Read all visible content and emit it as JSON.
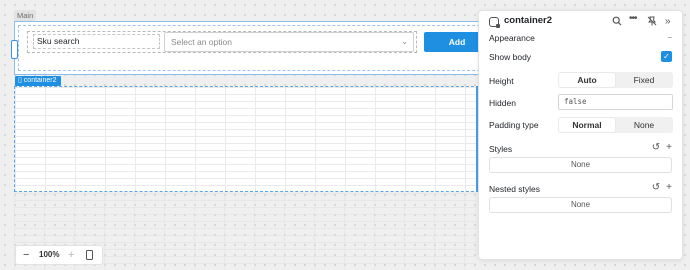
{
  "canvas": {
    "main_tag": "Main",
    "container_tag": "container2",
    "sku_label": "Sku search",
    "select_placeholder": "Select an option",
    "add_button_label": "Add",
    "zoom": {
      "minus": "−",
      "value": "100%",
      "plus": "+"
    }
  },
  "inspector": {
    "title": "container2",
    "icons": [
      "component-icon",
      "search-icon",
      "more-icon",
      "unpin-icon",
      "collapse-icon"
    ],
    "appearance_label": "Appearance",
    "show_body_label": "Show body",
    "show_body_checked": true,
    "height": {
      "label": "Height",
      "options": [
        "Auto",
        "Fixed"
      ],
      "selected": "Auto"
    },
    "hidden": {
      "label": "Hidden",
      "value": "false"
    },
    "padding": {
      "label": "Padding type",
      "options": [
        "Normal",
        "None"
      ],
      "selected": "Normal"
    },
    "styles": {
      "label": "Styles",
      "value": "None"
    },
    "nested_styles": {
      "label": "Nested styles",
      "value": "None"
    }
  },
  "colors": {
    "accent": "#1f8fe2",
    "selection_border": "#59a3ec"
  }
}
